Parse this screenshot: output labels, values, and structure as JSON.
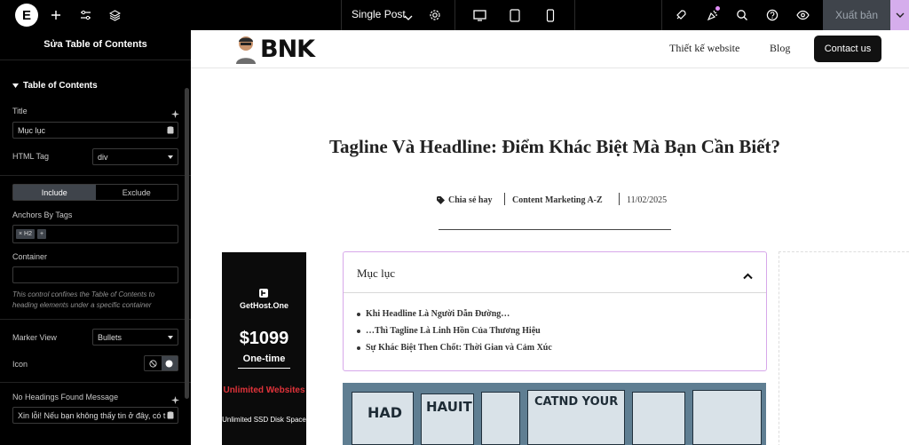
{
  "topbar": {
    "page_selector": "Single Post",
    "publish_label": "Xuất bản"
  },
  "panel": {
    "title": "Sửa Table of Contents",
    "section": "Table of Contents",
    "title_label": "Title",
    "title_value": "Mục lục",
    "html_tag_label": "HTML Tag",
    "html_tag_value": "div",
    "include_label": "Include",
    "exclude_label": "Exclude",
    "anchors_label": "Anchors By Tags",
    "anchor_tag": "H2",
    "container_label": "Container",
    "container_note": "This control confines the Table of Contents to heading elements under a specific container",
    "marker_label": "Marker View",
    "marker_value": "Bullets",
    "icon_label": "Icon",
    "no_headings_label": "No Headings Found Message",
    "no_headings_value": "Xin lỗi! Nếu bạn không thấy tin ở đây, có t"
  },
  "site": {
    "logo_text": "BNK",
    "nav": [
      "Thiết kế website",
      "Blog"
    ],
    "contact_label": "Contact us"
  },
  "post": {
    "title": "Tagline Và Headline: Điểm Khác Biệt Mà Bạn Cần Biết?",
    "category": "Chia sẻ hay",
    "tag": "Content Marketing A-Z",
    "date": "11/02/2025"
  },
  "toc": {
    "title": "Mục lục",
    "items": [
      "Khi Headline Là Người Dẫn Đường…",
      "…Thì Tagline Là Linh Hồn Của Thương Hiệu",
      "Sự Khác Biệt Then Chốt: Thời Gian và Cảm Xúc"
    ]
  },
  "ad": {
    "brand": "GetHost.One",
    "price": "$1099",
    "onetime": "One-time",
    "unlimited": "Unlimited Websites",
    "disk": "Unlimited SSD Disk Space"
  },
  "image": {
    "headline1": "HAD",
    "headline2": "HAUIT",
    "headline3": "CATND YOUR"
  },
  "colors": {
    "accent": "#d5adec",
    "toc_border": "#d7a8ea",
    "ad_red": "#e0333a"
  }
}
